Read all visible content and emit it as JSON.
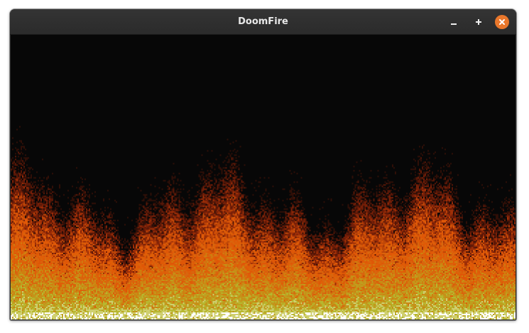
{
  "window": {
    "title": "DoomFire"
  },
  "controls": {
    "minimize": {
      "icon": "minimize-icon"
    },
    "maximize": {
      "icon": "maximize-icon"
    },
    "close": {
      "icon": "close-icon",
      "color": "#e9772b"
    }
  },
  "content": {
    "type": "fire-animation",
    "palette": [
      "#070707",
      "#2f0f07",
      "#571707",
      "#771f07",
      "#9f2f07",
      "#bf4707",
      "#df5707",
      "#df5f07",
      "#d7670f",
      "#cf7f0f",
      "#c78f17",
      "#bf9f1f",
      "#b7b72f",
      "#cfcf6f",
      "#ffffff"
    ]
  }
}
